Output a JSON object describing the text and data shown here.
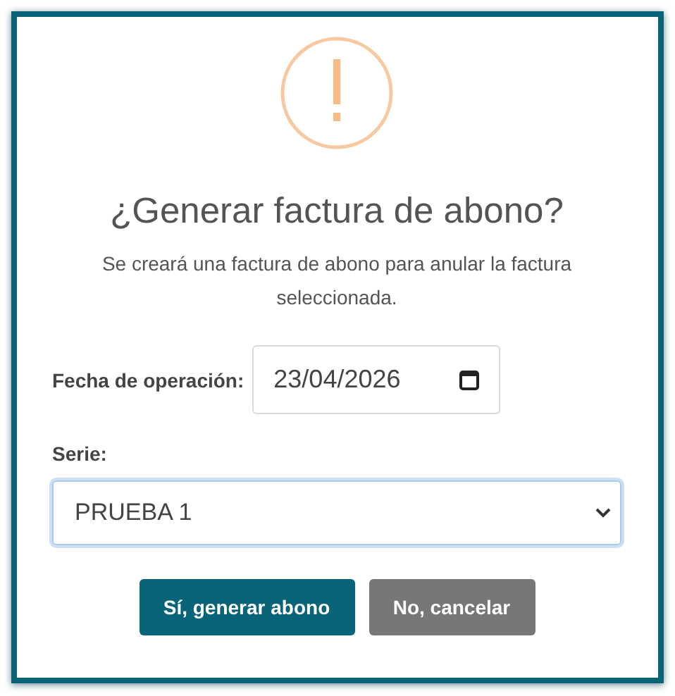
{
  "dialog": {
    "title": "¿Generar factura de abono?",
    "message": "Se creará una factura de abono para anular la factura seleccionada.",
    "date_field": {
      "label": "Fecha de operación:",
      "value": "23/04/2026"
    },
    "serie_field": {
      "label": "Serie:",
      "value": "PRUEBA 1",
      "focused": true
    },
    "buttons": [
      {
        "label": "Sí, generar abono",
        "kind": "primary"
      },
      {
        "label": "No, cancelar",
        "kind": "secondary"
      }
    ]
  }
}
